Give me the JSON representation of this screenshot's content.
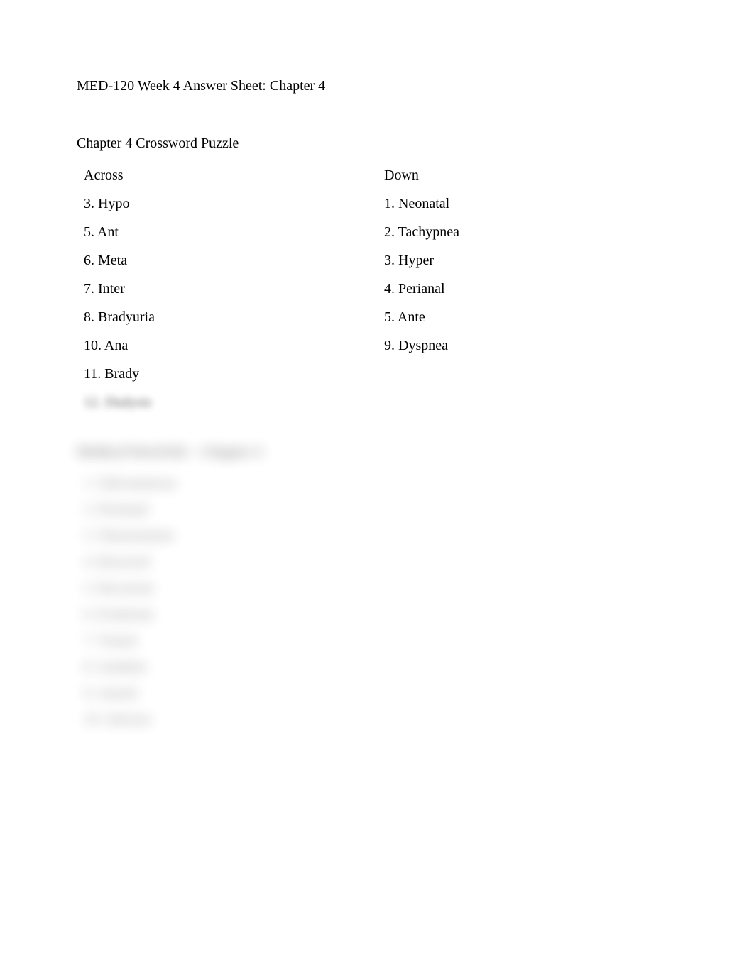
{
  "doc_title": "MED-120 Week 4 Answer Sheet: Chapter 4",
  "section1": {
    "title": "Chapter 4 Crossword Puzzle",
    "headers": {
      "left": "Across",
      "right": "Down"
    },
    "rows": [
      {
        "left": "3. Hypo",
        "right": "1. Neonatal"
      },
      {
        "left": "5. Ant",
        "right": "2. Tachypnea"
      },
      {
        "left": "6. Meta",
        "right": "3. Hyper"
      },
      {
        "left": "7. Inter",
        "right": "4. Perianal"
      },
      {
        "left": "8. Bradyuria",
        "right": "5. Ante"
      },
      {
        "left": "10. Ana",
        "right": "9. Dyspnea"
      },
      {
        "left": "11. Brady",
        "right": ""
      },
      {
        "left": "12. Dialysis",
        "right": ""
      }
    ]
  },
  "section2": {
    "title": "Medical Word Kit – Chapter 4",
    "rows": [
      "1. Subcutaneous",
      "2. Perinatal",
      "3. Thermometer",
      "4. Resected",
      "5. Recurrent",
      "6. Prodrome",
      "7. Transit",
      "8. Antidote",
      "9. Autoid",
      "10. Adverse"
    ]
  }
}
